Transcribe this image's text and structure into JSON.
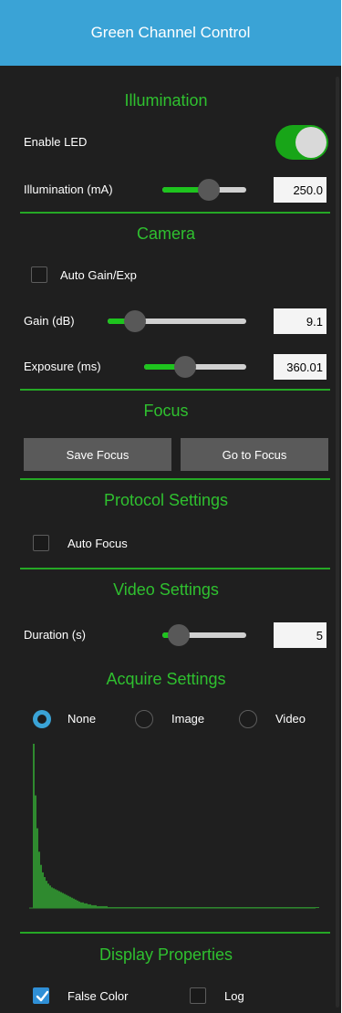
{
  "title": "Green Channel Control",
  "colors": {
    "header": "#3aa3d6",
    "accent": "#2fc02f",
    "panel": "#1f1f1f"
  },
  "illumination": {
    "title": "Illumination",
    "enable_led_label": "Enable LED",
    "enable_led_on": true,
    "illumination_label": "Illumination (mA)",
    "illumination_value": "250.0",
    "illumination_slider_fraction": 0.55
  },
  "camera": {
    "title": "Camera",
    "auto_gain_label": "Auto Gain/Exp",
    "auto_gain_checked": false,
    "gain_label": "Gain (dB)",
    "gain_value": "9.1",
    "gain_slider_fraction": 0.2,
    "exposure_label": "Exposure (ms)",
    "exposure_value": "360.01",
    "exposure_slider_fraction": 0.4
  },
  "focus": {
    "title": "Focus",
    "save_label": "Save Focus",
    "goto_label": "Go to Focus"
  },
  "protocol": {
    "title": "Protocol Settings",
    "auto_focus_label": "Auto Focus",
    "auto_focus_checked": false
  },
  "video": {
    "title": "Video Settings",
    "duration_label": "Duration (s)",
    "duration_value": "5",
    "duration_slider_fraction": 0.2
  },
  "acquire": {
    "title": "Acquire Settings",
    "options": [
      "None",
      "Image",
      "Video"
    ],
    "selected": "None"
  },
  "histogram": {
    "icon": "histogram",
    "color": "#2f8a2f",
    "max": 175,
    "values": [
      175,
      120,
      85,
      60,
      46,
      38,
      33,
      29,
      26,
      24,
      22,
      21,
      20,
      19,
      18,
      17,
      16,
      15,
      14,
      13,
      12,
      11,
      10,
      9,
      8,
      7,
      6,
      6,
      5,
      5,
      4,
      4,
      3,
      3,
      3,
      2,
      2,
      2,
      2,
      2,
      2,
      1,
      1,
      1,
      1,
      1,
      1,
      1,
      1,
      1,
      1,
      1,
      1,
      1,
      1,
      1,
      1,
      1,
      1,
      1,
      1,
      1,
      1,
      1,
      1,
      1,
      1,
      1,
      1,
      1,
      1,
      1,
      1,
      1,
      1,
      1,
      1,
      1,
      1,
      1,
      1,
      1,
      1,
      1,
      1,
      1,
      1,
      1,
      1,
      1,
      1,
      1,
      1,
      1,
      1,
      1,
      1,
      1,
      1,
      1,
      1,
      1,
      1,
      1,
      1,
      1,
      1,
      1,
      1,
      1,
      1,
      1,
      1,
      1,
      1,
      1,
      1,
      1,
      1,
      1,
      1,
      1,
      1,
      1,
      1,
      1,
      1,
      1,
      1,
      1,
      1,
      1,
      1,
      1,
      1,
      1,
      1,
      1,
      1,
      1,
      1,
      1,
      1,
      1,
      1,
      1,
      1,
      1,
      1,
      1,
      1,
      1,
      1,
      1,
      1,
      1,
      1
    ]
  },
  "display": {
    "title": "Display Properties",
    "false_color_label": "False Color",
    "false_color_checked": true,
    "log_label": "Log",
    "log_checked": false
  }
}
